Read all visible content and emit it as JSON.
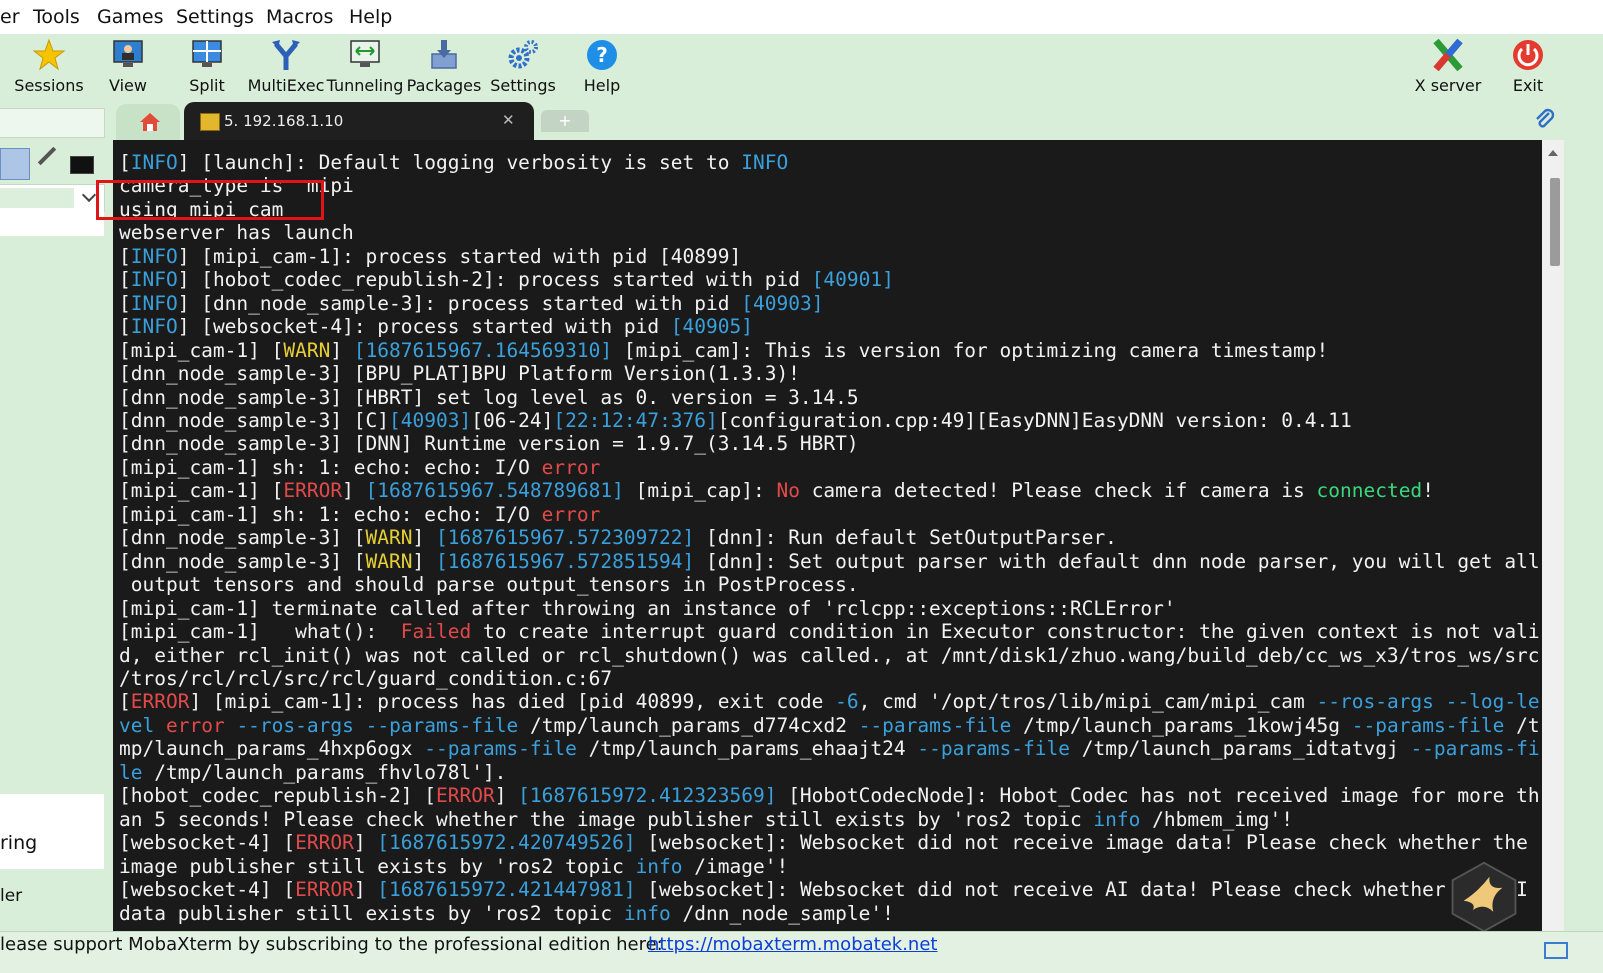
{
  "menu": [
    "er",
    "Tools",
    "Games",
    "Settings",
    "Macros",
    "Help"
  ],
  "toolbar": {
    "sessions": "Sessions",
    "view": "View",
    "split": "Split",
    "multiexec": "MultiExec",
    "tunneling": "Tunneling",
    "packages": "Packages",
    "settings": "Settings",
    "help": "Help",
    "xserver": "X server",
    "exit": "Exit"
  },
  "tabs": {
    "active_label": "5. 192.168.1.10",
    "close_symbol": "✕",
    "new_tab_symbol": "+"
  },
  "sidebar": {
    "label_ring": "ring",
    "label_ler": "ler"
  },
  "terminal_lines": [
    "[INFO] [launch]: Default logging verbosity is set to INFO",
    "camera_type is  mipi",
    "using mipi cam",
    "webserver has launch",
    "[INFO] [mipi_cam-1]: process started with pid [40899]",
    "[INFO] [hobot_codec_republish-2]: process started with pid [40901]",
    "[INFO] [dnn_node_sample-3]: process started with pid [40903]",
    "[INFO] [websocket-4]: process started with pid [40905]",
    "[mipi_cam-1] [WARN] [1687615967.164569310] [mipi_cam]: This is version for optimizing camera timestamp!",
    "[dnn_node_sample-3] [BPU_PLAT]BPU Platform Version(1.3.3)!",
    "[dnn_node_sample-3] [HBRT] set log level as 0. version = 3.14.5",
    "[dnn_node_sample-3] [C][40903][06-24][22:12:47:376][configuration.cpp:49][EasyDNN]EasyDNN version: 0.4.11",
    "[dnn_node_sample-3] [DNN] Runtime version = 1.9.7_(3.14.5 HBRT)",
    "[mipi_cam-1] sh: 1: echo: echo: I/O error",
    "[mipi_cam-1] [ERROR] [1687615967.548789681] [mipi_cap]: No camera detected! Please check if camera is connected!",
    "[mipi_cam-1] sh: 1: echo: echo: I/O error",
    "[dnn_node_sample-3] [WARN] [1687615967.572309722] [dnn]: Run default SetOutputParser.",
    "[dnn_node_sample-3] [WARN] [1687615967.572851594] [dnn]: Set output parser with default dnn node parser, you will get all",
    " output tensors and should parse output_tensors in PostProcess.",
    "[mipi_cam-1] terminate called after throwing an instance of 'rclcpp::exceptions::RCLError'",
    "[mipi_cam-1]   what():  Failed to create interrupt guard condition in Executor constructor: the given context is not vali",
    "d, either rcl_init() was not called or rcl_shutdown() was called., at /mnt/disk1/zhuo.wang/build_deb/cc_ws_x3/tros_ws/src",
    "/tros/rcl/rcl/src/rcl/guard_condition.c:67",
    "[ERROR] [mipi_cam-1]: process has died [pid 40899, exit code -6, cmd '/opt/tros/lib/mipi_cam/mipi_cam --ros-args --log-le",
    "vel error --ros-args --params-file /tmp/launch_params_d774cxd2 --params-file /tmp/launch_params_1kowj45g --params-file /t",
    "mp/launch_params_4hxp6ogx --params-file /tmp/launch_params_ehaajt24 --params-file /tmp/launch_params_idtatvgj --params-fi",
    "le /tmp/launch_params_fhvlo78l'].",
    "[hobot_codec_republish-2] [ERROR] [1687615972.412323569] [HobotCodecNode]: Hobot_Codec has not received image for more th",
    "an 5 seconds! Please check whether the image publisher still exists by 'ros2 topic info /hbmem_img'!",
    "[websocket-4] [ERROR] [1687615972.420749526] [websocket]: Websocket did not receive image data! Please check whether the",
    "image publisher still exists by 'ros2 topic info /image'!",
    "[websocket-4] [ERROR] [1687615972.421447981] [websocket]: Websocket did not receive AI data! Please check whether the AI",
    "data publisher still exists by 'ros2 topic info /dnn_node_sample'!"
  ],
  "status": {
    "text": "lease support MobaXterm by subscribing to the professional edition here:",
    "link": "https://mobaxterm.mobatek.net"
  },
  "colors": {
    "info_cyan": "#3aa0dc",
    "error_red": "#e24a4a",
    "warn_yellow": "#e6cf35",
    "ok_green": "#3ad87c",
    "highlight_box": "#e01616"
  }
}
